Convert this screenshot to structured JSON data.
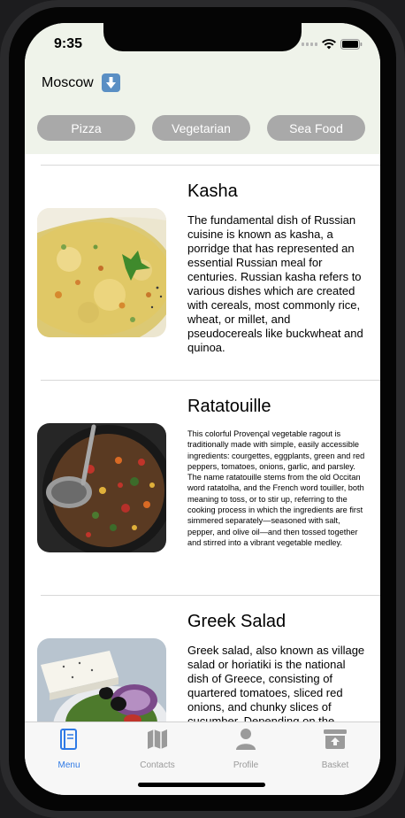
{
  "status_bar": {
    "time": "9:35"
  },
  "header": {
    "location": "Moscow"
  },
  "categories": [
    {
      "label": "Pizza"
    },
    {
      "label": "Vegetarian"
    },
    {
      "label": "Sea Food"
    }
  ],
  "dishes": [
    {
      "name": "Kasha",
      "description": "The fundamental dish of Russian cuisine is known as kasha, a porridge that has represented an essential Russian meal for centuries. Russian kasha refers to various dishes which are created with cereals, most commonly rice, wheat, or millet, and pseudocereals like buckwheat and quinoa."
    },
    {
      "name": "Ratatouille",
      "description": "This colorful Provençal vegetable ragout is traditionally made with simple, easily accessible ingredients: courgettes, eggplants, green and red peppers, tomatoes, onions, garlic, and parsley. The name ratatouille stems from the old Occitan word ratatolha, and the French word touiller, both meaning to toss, or to stir up, referring to the cooking process in which the ingredients are first simmered separately—seasoned with salt, pepper, and olive oil—and then tossed together and stirred into a vibrant vegetable medley."
    },
    {
      "name": "Greek Salad",
      "description": "Greek salad, also known as village salad or horiatiki is the national dish of Greece, consisting of quartered tomatoes, sliced red onions, and chunky slices of cucumber. Depending on the"
    }
  ],
  "tab_bar": {
    "active_color": "#2f7ae5",
    "inactive_color": "#9a9a9a",
    "items": [
      {
        "label": "Menu",
        "icon": "menu-book-icon",
        "active": true
      },
      {
        "label": "Contacts",
        "icon": "map-icon",
        "active": false
      },
      {
        "label": "Profile",
        "icon": "person-icon",
        "active": false
      },
      {
        "label": "Basket",
        "icon": "basket-icon",
        "active": false
      }
    ]
  }
}
